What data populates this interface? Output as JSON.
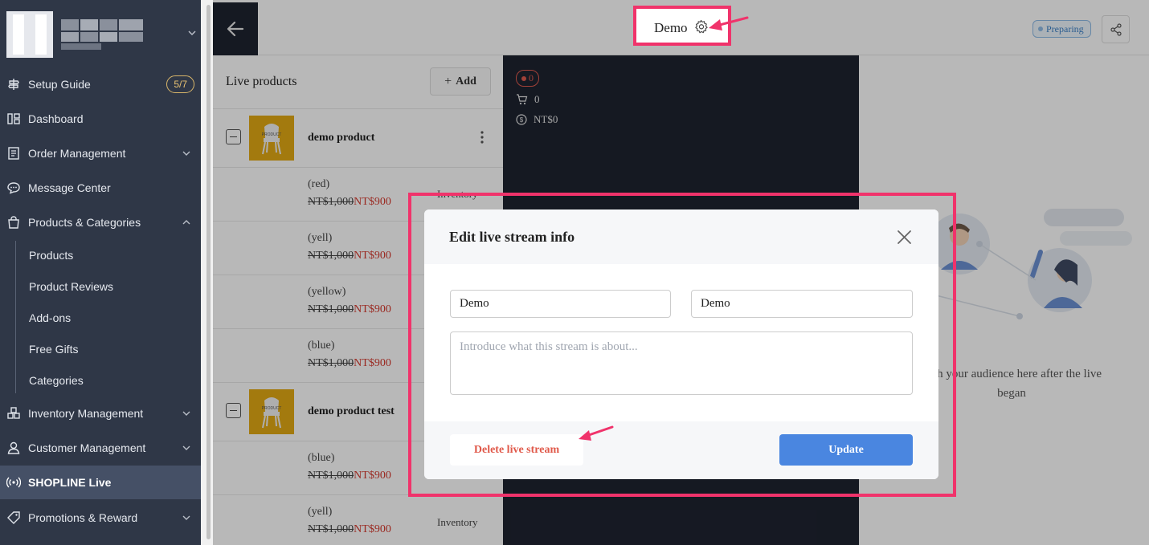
{
  "sidebar": {
    "setup_guide": {
      "label": "Setup Guide",
      "badge": "5/7"
    },
    "items": [
      {
        "label": "Dashboard"
      },
      {
        "label": "Order Management"
      },
      {
        "label": "Message Center"
      },
      {
        "label": "Products & Categories"
      },
      {
        "label": "Inventory Management"
      },
      {
        "label": "Customer Management"
      },
      {
        "label": "SHOPLINE Live"
      },
      {
        "label": "Promotions & Reward"
      }
    ],
    "sub_items": [
      "Products",
      "Product Reviews",
      "Add-ons",
      "Free Gifts",
      "Categories"
    ]
  },
  "header": {
    "title": "Demo",
    "status": "Preparing"
  },
  "products_panel": {
    "title": "Live products",
    "add_label": "Add",
    "inventory_label": "Inventory",
    "products": [
      {
        "name": "demo product",
        "thumb_text": "PRODUCT",
        "variants": [
          {
            "name": "(red)",
            "old_price": "NT$1,000",
            "new_price": "NT$900"
          },
          {
            "name": "(yell)",
            "old_price": "NT$1,000",
            "new_price": "NT$900"
          },
          {
            "name": "(yellow)",
            "old_price": "NT$1,000",
            "new_price": "NT$900"
          },
          {
            "name": "(blue)",
            "old_price": "NT$1,000",
            "new_price": "NT$900"
          }
        ]
      },
      {
        "name": "demo product test",
        "thumb_text": "PRODUCT",
        "variants": [
          {
            "name": "(blue)",
            "old_price": "NT$1,000",
            "new_price": "NT$900"
          },
          {
            "name": "(yell)",
            "old_price": "NT$1,000",
            "new_price": "NT$900"
          }
        ]
      }
    ]
  },
  "stream_stats": {
    "viewers": "0",
    "orders": "0",
    "revenue": "NT$0"
  },
  "chat_panel": {
    "empty_text": "with your audience here after the live began"
  },
  "modal": {
    "title": "Edit live stream info",
    "field1_value": "Demo",
    "field2_value": "Demo",
    "description_placeholder": "Introduce what this stream is about...",
    "delete_label": "Delete live stream",
    "update_label": "Update"
  },
  "colors": {
    "sidebar_bg": "#2f3747",
    "accent_blue": "#4a86e0",
    "danger": "#e0594a",
    "highlight": "#f0336b",
    "price_red": "#d63a2f"
  }
}
